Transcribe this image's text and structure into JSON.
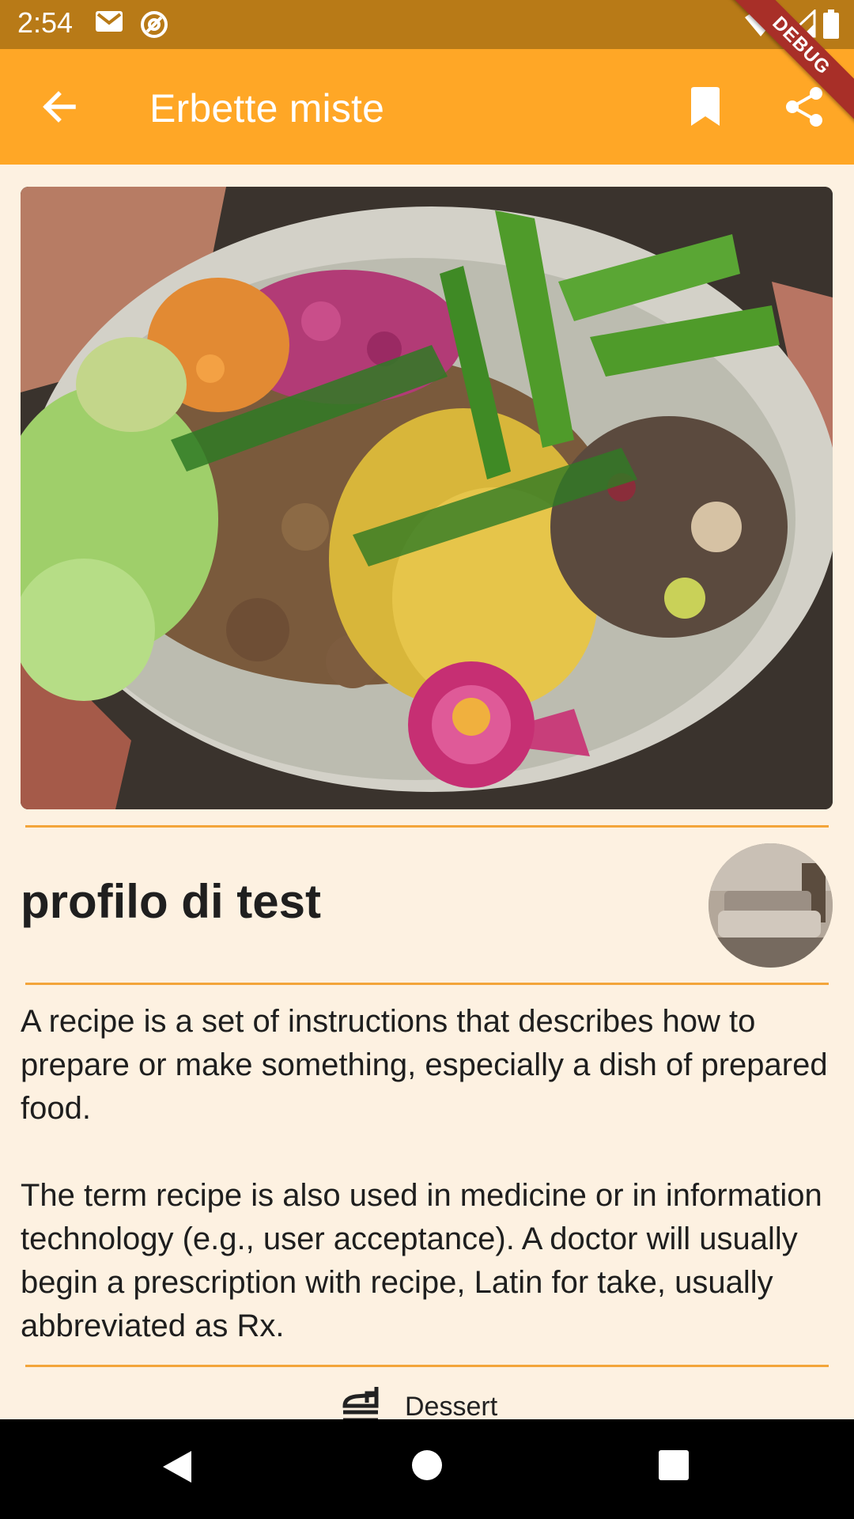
{
  "status_bar": {
    "time": "2:54"
  },
  "app_bar": {
    "title": "Erbette miste"
  },
  "debug_banner": "DEBUG",
  "recipe": {
    "author": "profilo di test",
    "description_paragraphs": [
      "A recipe is a set of instructions that describes how to prepare or make something, especially a dish of prepared food.",
      "The term recipe is also used in medicine or in information technology (e.g., user acceptance). A doctor will usually begin a prescription with recipe, Latin for take, usually abbreviated as Rx."
    ],
    "category": "Dessert"
  },
  "colors": {
    "status_bar": "#b87a17",
    "app_bar": "#ffa726",
    "background": "#fdf1e1",
    "divider": "#f3a53a",
    "debug_ribbon": "#a82f28"
  },
  "icons": {
    "status": [
      "gmail-icon",
      "at-sign-icon",
      "wifi-icon",
      "signal-icon",
      "battery-icon"
    ],
    "app_bar": [
      "arrow-back-icon",
      "bookmark-icon",
      "share-icon"
    ],
    "category": "dessert-icon",
    "navigation": [
      "nav-back-icon",
      "nav-home-icon",
      "nav-recents-icon"
    ]
  }
}
